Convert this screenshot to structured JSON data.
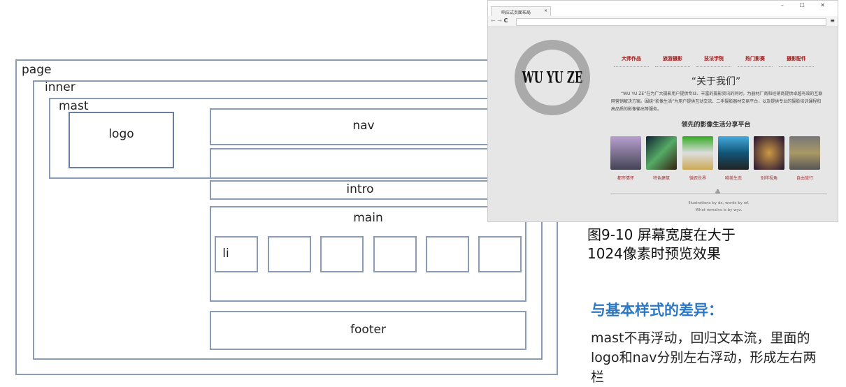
{
  "diagram": {
    "page": "page",
    "inner": "inner",
    "mast": "mast",
    "logo": "logo",
    "nav": "nav",
    "intro": "intro",
    "main": "main",
    "li": "li",
    "footer": "footer"
  },
  "browser": {
    "tab_title": "响应式页面布局",
    "brand": "WU YU ZE",
    "nav": [
      "大师作品",
      "旅游摄影",
      "技法学院",
      "热门影赛",
      "摄影配件"
    ],
    "about_title": "“关于我们”",
    "about_text": "“WU YU ZE”在为广大摄影用户提供专业、丰富的摄影资讯的同时，为器材厂商和经销商提供卓越有效的互联网营销解决方案。围绕“影像生活”为用户提供互动交流、二手摄影器材交易平台，以及提供专业的摄影培训课程和高品质的影像输出等服务。",
    "platform_title": "领先的影像生活分享平台",
    "thumbs": [
      "都市情怀",
      "特色建筑",
      "微距世界",
      "唯美生态",
      "别样视角",
      "自由旅行"
    ],
    "footer1": "Illustrations by dx, words by wf.",
    "footer2": "What remains is by wyz."
  },
  "caption": {
    "line1": "图9-10  屏幕宽度在大于",
    "line2": "1024像素时预览效果"
  },
  "diff": {
    "title": "与基本样式的差异：",
    "text": "mast不再浮动，回归文本流，里面的logo和nav分别左右浮动，形成左右两栏"
  }
}
